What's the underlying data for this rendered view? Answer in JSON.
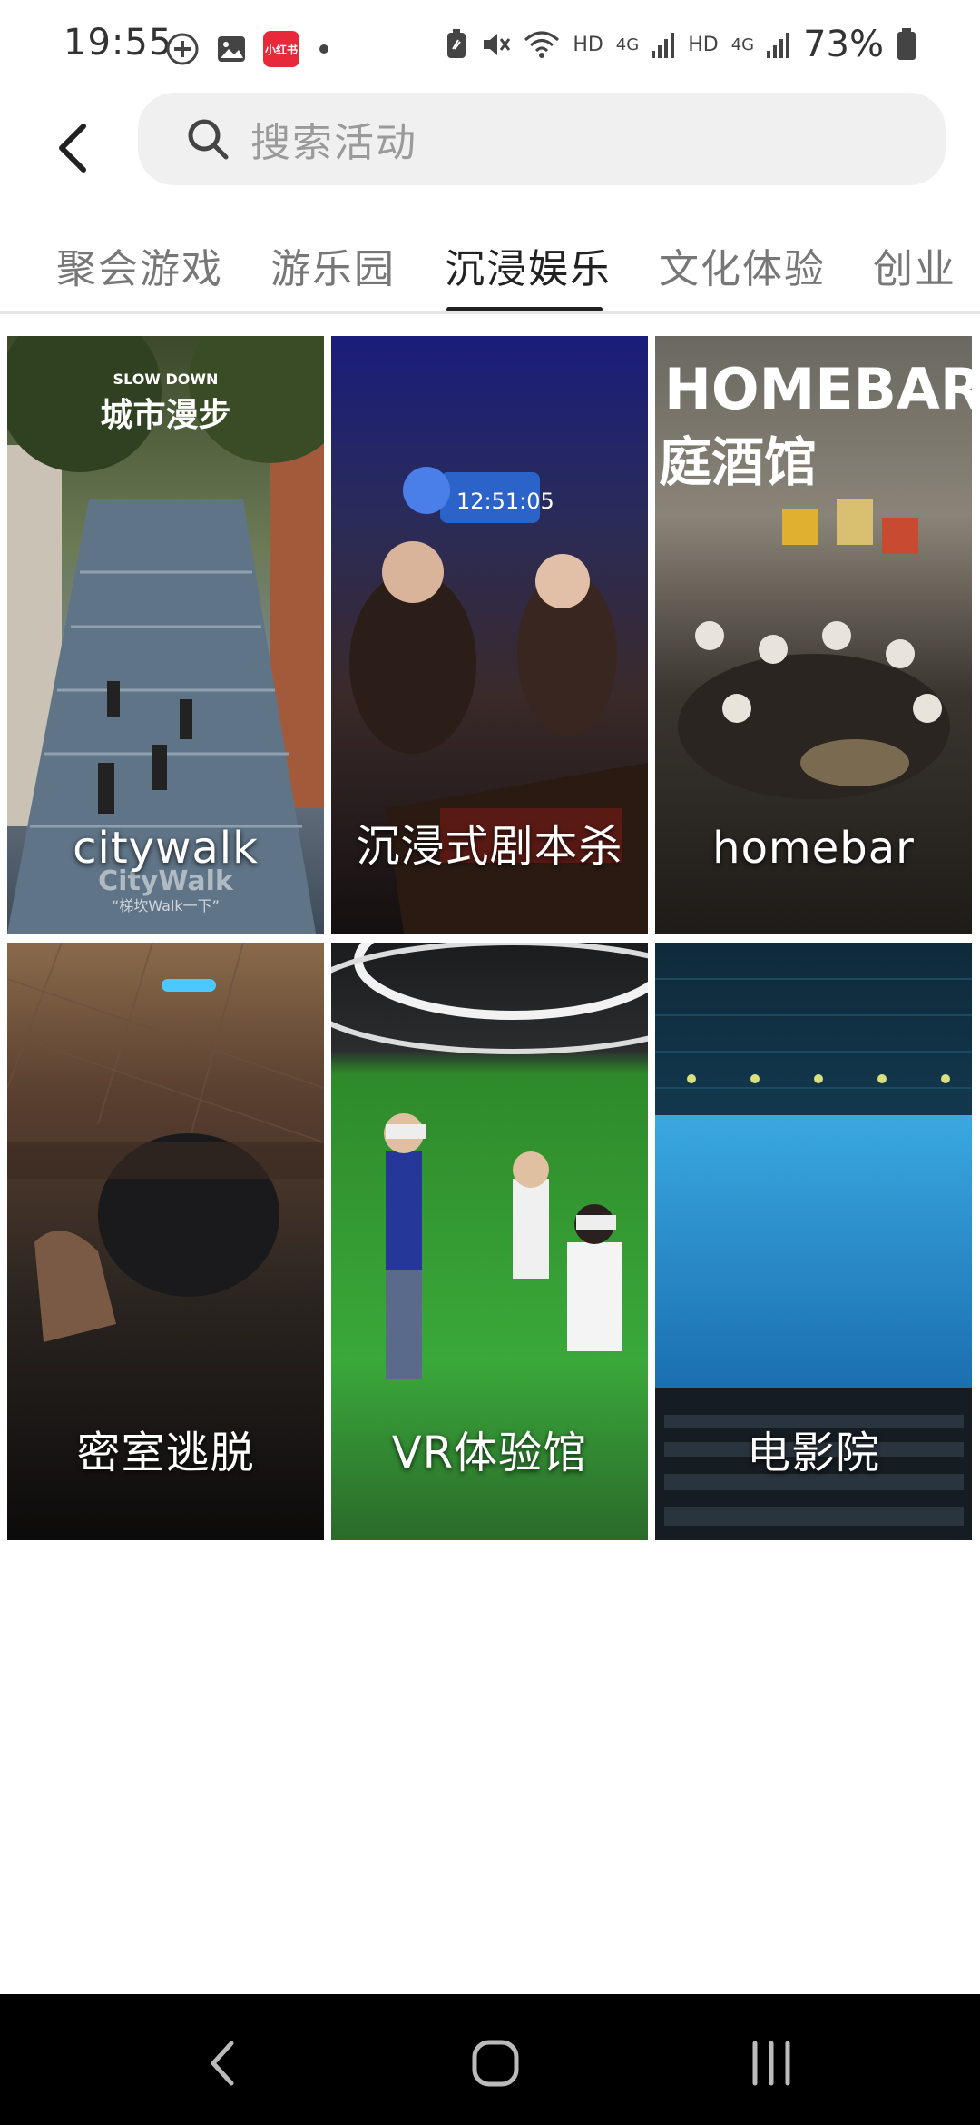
{
  "status_bar": {
    "time": "19:55",
    "app_badge": "小红书",
    "network_1": "HD",
    "network_2": "4G",
    "network_3": "HD",
    "network_4": "4G",
    "battery": "73%"
  },
  "search": {
    "placeholder": "搜索活动"
  },
  "tabs": [
    {
      "label": "聚会游戏"
    },
    {
      "label": "游乐园"
    },
    {
      "label": "沉浸娱乐"
    },
    {
      "label": "文化体验"
    },
    {
      "label": "创业"
    }
  ],
  "active_tab": "沉浸娱乐",
  "tiles": [
    {
      "label": "citywalk",
      "overlay_title": "城市漫步",
      "overlay_sub": "SLOW DOWN",
      "overlay_bottom": "CityWalk",
      "overlay_caption": "“梯坎Walk一下”"
    },
    {
      "label": "沉浸式剧本杀",
      "overlay_clock": "12:51:05"
    },
    {
      "label": "homebar",
      "overlay_title": "HOMEBAR",
      "overlay_sub": "庭酒馆"
    },
    {
      "label": "密室逃脱"
    },
    {
      "label": "VR体验馆"
    },
    {
      "label": "电影院"
    }
  ],
  "colors": {
    "accent": "#222222",
    "tab_inactive": "#777777",
    "search_bg": "#f0f0f0",
    "app_badge": "#e8293a"
  },
  "icons": {
    "back": "chevron-left-icon",
    "search": "search-icon",
    "nav_back": "nav-back-icon",
    "nav_home": "nav-home-icon",
    "nav_recents": "nav-recents-icon"
  }
}
